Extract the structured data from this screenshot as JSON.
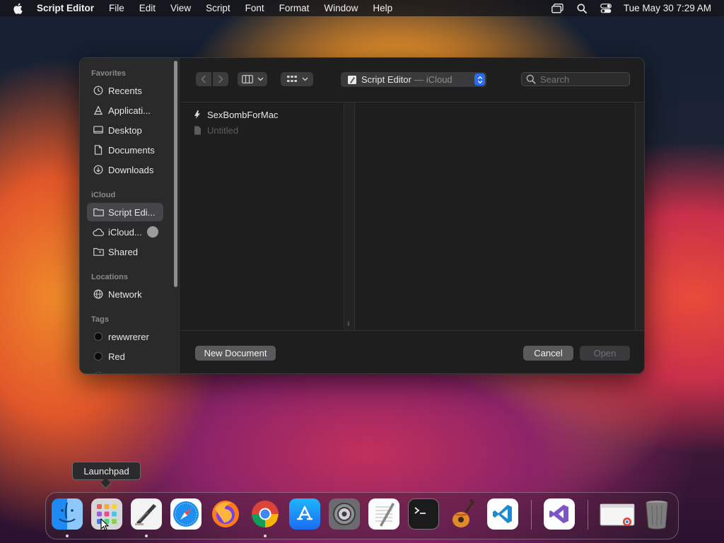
{
  "menubar": {
    "app_name": "Script Editor",
    "menus": [
      "File",
      "Edit",
      "View",
      "Script",
      "Font",
      "Format",
      "Window",
      "Help"
    ],
    "status_icons": [
      "screen-mirroring-icon",
      "spotlight-search-icon",
      "control-center-icon"
    ],
    "clock": "Tue May 30  7:29 AM"
  },
  "sidebar": {
    "sections": {
      "favorites": "Favorites",
      "icloud": "iCloud",
      "locations": "Locations",
      "tags": "Tags"
    },
    "favorites": [
      {
        "label": "Recents",
        "icon": "clock-icon"
      },
      {
        "label": "Applicati...",
        "icon": "applications-icon"
      },
      {
        "label": "Desktop",
        "icon": "desktop-icon"
      },
      {
        "label": "Documents",
        "icon": "document-icon"
      },
      {
        "label": "Downloads",
        "icon": "download-icon"
      }
    ],
    "icloud": [
      {
        "label": "Script Edi...",
        "icon": "folder-icon",
        "selected": true
      },
      {
        "label": "iCloud...",
        "icon": "cloud-icon"
      },
      {
        "label": "Shared",
        "icon": "shared-folder-icon"
      }
    ],
    "locations": [
      {
        "label": "Network",
        "icon": "globe-icon"
      }
    ],
    "tags": [
      {
        "label": "rewwrerer",
        "color": "#0b0b0b"
      },
      {
        "label": "Red",
        "color": "#0b0b0b"
      },
      {
        "label": "O",
        "color": "#0b0b0b"
      }
    ]
  },
  "toolbar": {
    "location_label": "Script Editor",
    "location_separator": "—",
    "location_sub": "iCloud",
    "search_placeholder": "Search"
  },
  "files": [
    {
      "name": "SexBombForMac",
      "icon": "script-icon",
      "dimmed": false
    },
    {
      "name": "Untitled",
      "icon": "document-icon",
      "dimmed": true
    }
  ],
  "footer": {
    "new_document": "New Document",
    "cancel": "Cancel",
    "open": "Open"
  },
  "tooltip": {
    "text": "Launchpad"
  },
  "dock": {
    "apps": [
      {
        "name": "finder-icon",
        "running": true
      },
      {
        "name": "launchpad-icon",
        "running": false
      },
      {
        "name": "script-editor-icon",
        "running": true
      },
      {
        "name": "safari-icon",
        "running": false
      },
      {
        "name": "firefox-icon",
        "running": false
      },
      {
        "name": "chrome-icon",
        "running": true
      },
      {
        "name": "app-store-icon",
        "running": false
      },
      {
        "name": "system-settings-icon",
        "running": false
      },
      {
        "name": "textedit-icon",
        "running": false
      },
      {
        "name": "terminal-icon",
        "running": false
      },
      {
        "name": "garageband-icon",
        "running": false
      },
      {
        "name": "vscode-icon",
        "running": false
      },
      {
        "name": "visual-studio-icon",
        "running": false
      },
      {
        "name": "chrome-window-icon",
        "running": false
      },
      {
        "name": "trash-icon",
        "running": false
      }
    ]
  },
  "colors": {
    "accent": "#2a6bf2",
    "sidebar_bg": "#2a2a2b",
    "dialog_bg": "#1e1e1e"
  }
}
